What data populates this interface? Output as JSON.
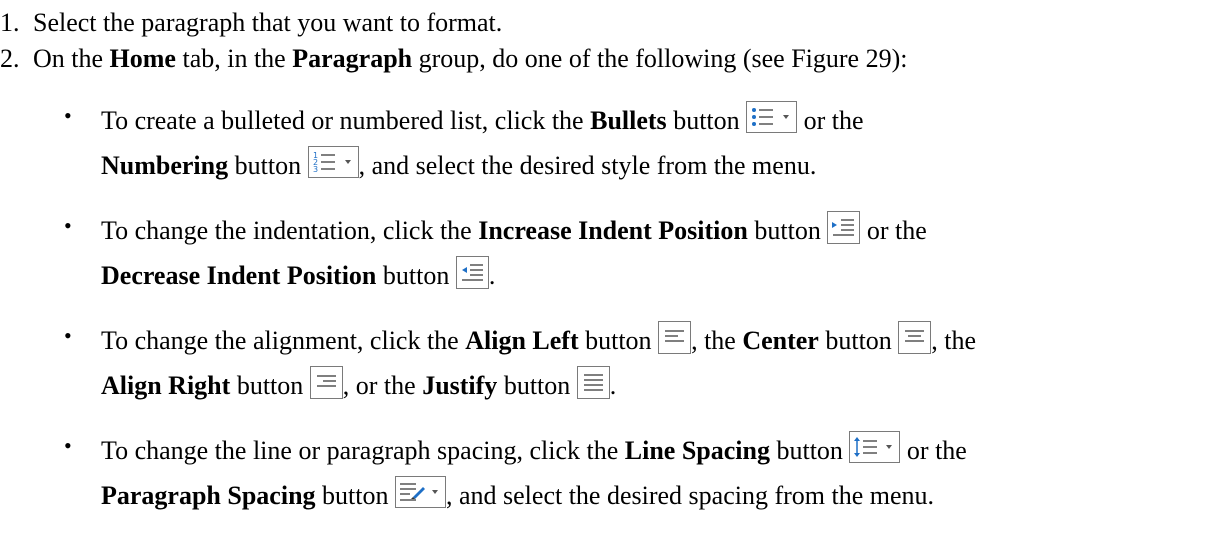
{
  "steps": [
    {
      "number": "1.",
      "text": "Select the paragraph that you want to format."
    },
    {
      "number": "2.",
      "pre": "On the ",
      "b1": "Home",
      "mid1": " tab, in the ",
      "b2": "Paragraph",
      "post": " group, do one of the following (see Figure 29):"
    }
  ],
  "bullet_char": "•",
  "items": {
    "lists": {
      "pre": "To create a bulleted or numbered list, click the ",
      "b1": "Bullets",
      "mid1": " button ",
      "post1": " or the",
      "b2": "Numbering",
      "mid2": " button ",
      "post2": ", and select the desired style from the menu."
    },
    "indent": {
      "pre": "To change the indentation, click the ",
      "b1": "Increase Indent Position",
      "mid1": " button ",
      "post1": " or the",
      "b2": "Decrease Indent Position",
      "mid2": " button ",
      "post2": "."
    },
    "align": {
      "pre": "To change the alignment, click the ",
      "b1": "Align Left",
      "mid1": " button ",
      "sep1": ", the ",
      "b2": "Center",
      "mid2": " button ",
      "post1": ", the",
      "b3": "Align Right",
      "mid3": " button ",
      "sep2": ", or the ",
      "b4": "Justify",
      "mid4": " button ",
      "post2": "."
    },
    "spacing": {
      "pre": "To change the line or paragraph spacing, click the ",
      "b1": "Line Spacing",
      "mid1": " button ",
      "post1": " or the",
      "b2": "Paragraph Spacing",
      "mid2": " button ",
      "post2": ", and select the desired spacing from the menu."
    }
  },
  "icons": {
    "accent": "#1e6fc6",
    "line_color": "#555555",
    "border_color": "#7a7a7a"
  }
}
